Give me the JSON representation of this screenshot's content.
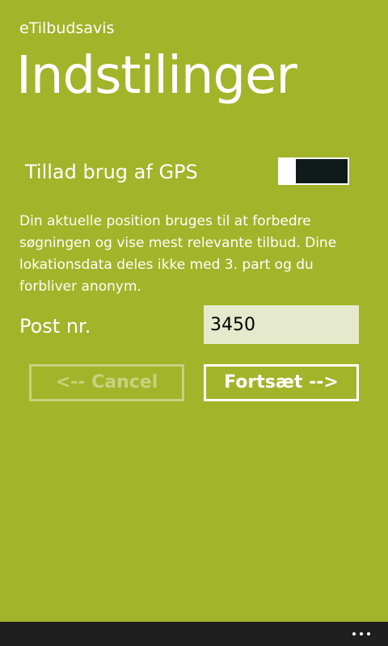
{
  "app": {
    "name": "eTilbudsavis"
  },
  "page": {
    "title": "Indstilinger"
  },
  "gps": {
    "label": "Tillad brug af GPS",
    "enabled": false,
    "description": "Din aktuelle position bruges til at forbedre søgningen og vise mest relevante tilbud. Dine lokationsdata deles ikke med 3. part og du forbliver anonym."
  },
  "postnr": {
    "label": "Post nr.",
    "value": "3450"
  },
  "buttons": {
    "cancel_label": "<-- Cancel",
    "continue_label": "Fortsæt -->"
  },
  "appbar": {
    "more_icon": "more-ellipsis-icon"
  },
  "colors": {
    "accent_background": "#a2b429",
    "input_background": "#e6eacc",
    "toggle_track": "#0f1a1a",
    "appbar_background": "#1f1f1f"
  }
}
